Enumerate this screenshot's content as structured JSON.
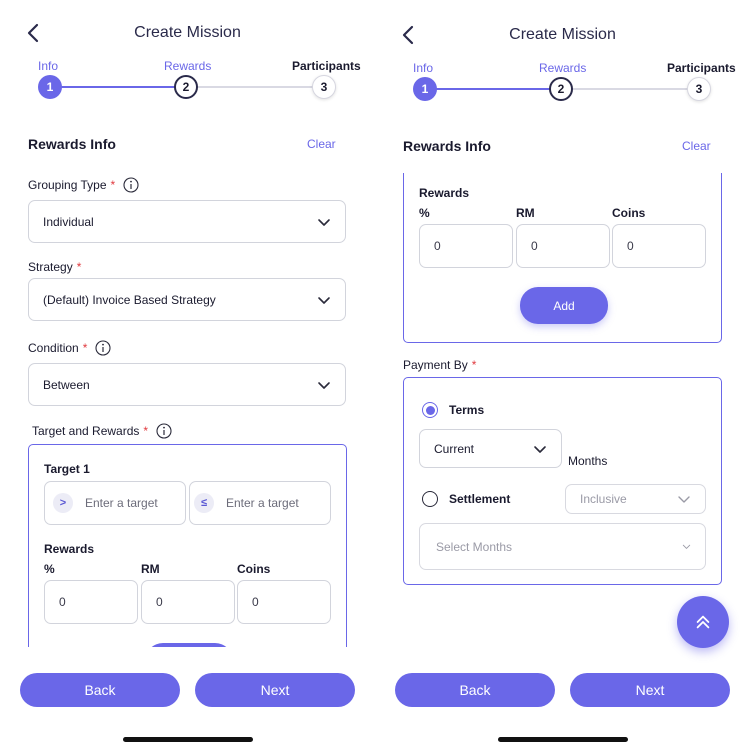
{
  "left": {
    "header": {
      "title": "Create Mission",
      "back_icon": "chevron-left-icon"
    },
    "stepper": {
      "labels": [
        "Info",
        "Rewards",
        "Participants"
      ],
      "numbers": [
        "1",
        "2",
        "3"
      ]
    },
    "section": {
      "title": "Rewards Info",
      "clear_label": "Clear"
    },
    "grouping": {
      "label": "Grouping Type",
      "required": "*",
      "value": "Individual"
    },
    "strategy": {
      "label": "Strategy",
      "required": "*",
      "value": "(Default) Invoice Based Strategy"
    },
    "condition": {
      "label": "Condition",
      "required": "*",
      "value": "Between"
    },
    "target_rewards": {
      "label": "Target and Rewards",
      "required": "*",
      "target_title": "Target 1",
      "op_gt": ">",
      "op_le": "≤",
      "target_placeholder_1": "Enter a target",
      "target_placeholder_2": "Enter a target",
      "rewards_label": "Rewards",
      "col_percent": "%",
      "col_rm": "RM",
      "col_coins": "Coins",
      "val_percent": "0",
      "val_rm": "0",
      "val_coins": "0"
    },
    "footer": {
      "back_label": "Back",
      "next_label": "Next"
    }
  },
  "right": {
    "header": {
      "title": "Create Mission",
      "back_icon": "chevron-left-icon"
    },
    "stepper": {
      "labels": [
        "Info",
        "Rewards",
        "Participants"
      ],
      "numbers": [
        "1",
        "2",
        "3"
      ]
    },
    "section": {
      "title": "Rewards Info",
      "clear_label": "Clear"
    },
    "rewards": {
      "label": "Rewards",
      "col_percent": "%",
      "col_rm": "RM",
      "col_coins": "Coins",
      "val_percent": "0",
      "val_rm": "0",
      "val_coins": "0",
      "add_label": "Add"
    },
    "payment": {
      "label": "Payment By",
      "required": "*",
      "terms_label": "Terms",
      "terms_selected": true,
      "terms_value": "Current",
      "months_label": "Months",
      "settlement_label": "Settlement",
      "settlement_value": "Inclusive",
      "select_months_placeholder": "Select Months"
    },
    "fab_icon": "double-chevron-up-icon",
    "footer": {
      "back_label": "Back",
      "next_label": "Next"
    }
  },
  "colors": {
    "accent": "#6a67e8",
    "required": "#e0393e",
    "border": "#d2d4dc"
  }
}
